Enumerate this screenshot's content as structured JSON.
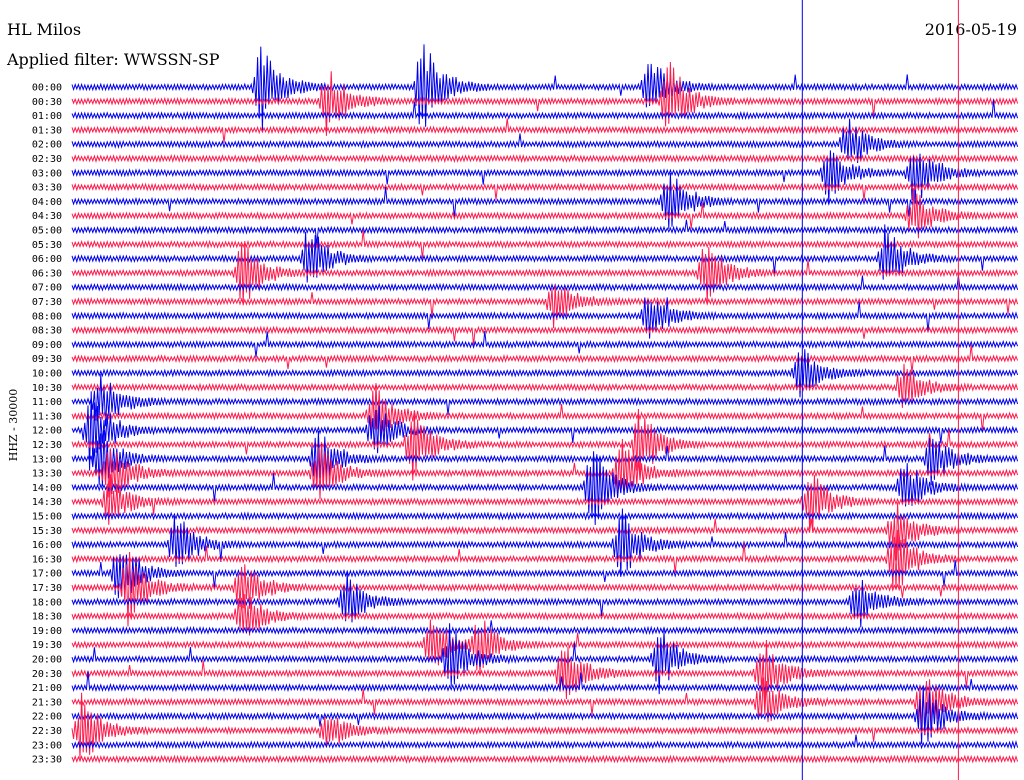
{
  "header": {
    "station": "HL Milos",
    "filter": "Applied filter: WWSSN-SP",
    "date": "2016-05-19"
  },
  "chart_data": {
    "type": "line",
    "title": "HL Milos",
    "subtitle": "Applied filter: WWSSN-SP",
    "date": "2016-05-19",
    "ylabel": "HHZ - 30000",
    "xlabel": "",
    "grid": false,
    "colors": {
      "even": "#0000ee",
      "odd": "#ff1a4b",
      "marker_blue": "#0000ee",
      "marker_red": "#ff1a4b"
    },
    "markers": [
      {
        "color": "blue",
        "x": 0.772
      },
      {
        "color": "red",
        "x": 0.937
      }
    ],
    "rows": [
      "00:00",
      "00:30",
      "01:00",
      "01:30",
      "02:00",
      "02:30",
      "03:00",
      "03:30",
      "04:00",
      "04:30",
      "05:00",
      "05:30",
      "06:00",
      "06:30",
      "07:00",
      "07:30",
      "08:00",
      "08:30",
      "09:00",
      "09:30",
      "10:00",
      "10:30",
      "11:00",
      "11:30",
      "12:00",
      "12:30",
      "13:00",
      "13:30",
      "14:00",
      "14:30",
      "15:00",
      "15:30",
      "16:00",
      "16:30",
      "17:00",
      "17:30",
      "18:00",
      "18:30",
      "19:00",
      "19:30",
      "20:00",
      "20:30",
      "21:00",
      "21:30",
      "22:00",
      "22:30",
      "23:00",
      "23:30"
    ],
    "events": [
      {
        "row": 0,
        "x": 0.2,
        "amp": 3.2
      },
      {
        "row": 0,
        "x": 0.37,
        "amp": 3.5
      },
      {
        "row": 0,
        "x": 0.61,
        "amp": 2.2
      },
      {
        "row": 1,
        "x": 0.27,
        "amp": 2.5
      },
      {
        "row": 1,
        "x": 0.63,
        "amp": 3.0
      },
      {
        "row": 4,
        "x": 0.82,
        "amp": 2.0
      },
      {
        "row": 6,
        "x": 0.8,
        "amp": 2.0
      },
      {
        "row": 6,
        "x": 0.89,
        "amp": 2.6
      },
      {
        "row": 8,
        "x": 0.63,
        "amp": 2.6
      },
      {
        "row": 9,
        "x": 0.89,
        "amp": 1.8
      },
      {
        "row": 12,
        "x": 0.25,
        "amp": 2.4
      },
      {
        "row": 12,
        "x": 0.86,
        "amp": 2.4
      },
      {
        "row": 13,
        "x": 0.18,
        "amp": 2.5
      },
      {
        "row": 13,
        "x": 0.67,
        "amp": 2.4
      },
      {
        "row": 15,
        "x": 0.51,
        "amp": 1.8
      },
      {
        "row": 16,
        "x": 0.61,
        "amp": 2.0
      },
      {
        "row": 20,
        "x": 0.77,
        "amp": 2.0
      },
      {
        "row": 21,
        "x": 0.88,
        "amp": 1.6
      },
      {
        "row": 22,
        "x": 0.03,
        "amp": 2.4
      },
      {
        "row": 23,
        "x": 0.32,
        "amp": 2.2
      },
      {
        "row": 24,
        "x": 0.02,
        "amp": 3.0
      },
      {
        "row": 24,
        "x": 0.32,
        "amp": 2.0
      },
      {
        "row": 25,
        "x": 0.36,
        "amp": 2.6
      },
      {
        "row": 25,
        "x": 0.6,
        "amp": 2.6
      },
      {
        "row": 26,
        "x": 0.03,
        "amp": 2.4
      },
      {
        "row": 26,
        "x": 0.26,
        "amp": 2.2
      },
      {
        "row": 26,
        "x": 0.91,
        "amp": 2.0
      },
      {
        "row": 27,
        "x": 0.04,
        "amp": 2.4
      },
      {
        "row": 27,
        "x": 0.26,
        "amp": 2.2
      },
      {
        "row": 27,
        "x": 0.58,
        "amp": 2.4
      },
      {
        "row": 28,
        "x": 0.55,
        "amp": 3.0
      },
      {
        "row": 28,
        "x": 0.88,
        "amp": 2.0
      },
      {
        "row": 29,
        "x": 0.04,
        "amp": 2.0
      },
      {
        "row": 29,
        "x": 0.78,
        "amp": 2.2
      },
      {
        "row": 31,
        "x": 0.87,
        "amp": 2.0
      },
      {
        "row": 32,
        "x": 0.11,
        "amp": 2.2
      },
      {
        "row": 32,
        "x": 0.58,
        "amp": 2.6
      },
      {
        "row": 33,
        "x": 0.87,
        "amp": 2.6
      },
      {
        "row": 34,
        "x": 0.05,
        "amp": 2.6
      },
      {
        "row": 35,
        "x": 0.06,
        "amp": 2.8
      },
      {
        "row": 35,
        "x": 0.18,
        "amp": 2.2
      },
      {
        "row": 36,
        "x": 0.29,
        "amp": 2.0
      },
      {
        "row": 36,
        "x": 0.83,
        "amp": 2.0
      },
      {
        "row": 37,
        "x": 0.18,
        "amp": 2.0
      },
      {
        "row": 39,
        "x": 0.38,
        "amp": 2.0
      },
      {
        "row": 39,
        "x": 0.43,
        "amp": 2.0
      },
      {
        "row": 40,
        "x": 0.4,
        "amp": 2.4
      },
      {
        "row": 40,
        "x": 0.62,
        "amp": 2.4
      },
      {
        "row": 41,
        "x": 0.52,
        "amp": 2.4
      },
      {
        "row": 41,
        "x": 0.73,
        "amp": 2.6
      },
      {
        "row": 43,
        "x": 0.73,
        "amp": 2.0
      },
      {
        "row": 43,
        "x": 0.9,
        "amp": 2.6
      },
      {
        "row": 44,
        "x": 0.9,
        "amp": 2.2
      },
      {
        "row": 45,
        "x": 0.01,
        "amp": 2.6
      },
      {
        "row": 45,
        "x": 0.27,
        "amp": 1.6
      }
    ]
  }
}
